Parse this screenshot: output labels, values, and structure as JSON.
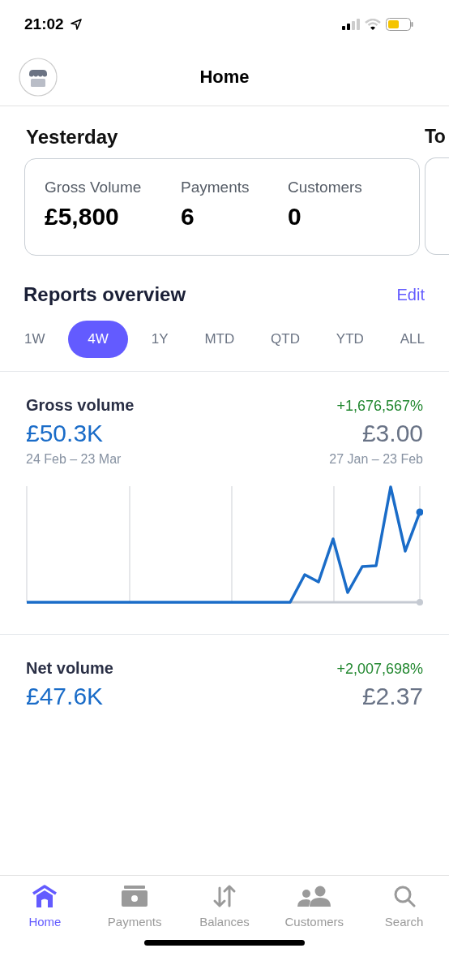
{
  "status_bar": {
    "time": "21:02"
  },
  "header": {
    "title": "Home"
  },
  "summaries": [
    {
      "title": "Yesterday",
      "stats": [
        {
          "label": "Gross Volume",
          "value": "£5,800"
        },
        {
          "label": "Payments",
          "value": "6"
        },
        {
          "label": "Customers",
          "value": "0"
        }
      ]
    },
    {
      "title": "To"
    }
  ],
  "reports": {
    "title": "Reports overview",
    "edit": "Edit",
    "periods": [
      {
        "label": "1W",
        "selected": false
      },
      {
        "label": "4W",
        "selected": true
      },
      {
        "label": "1Y",
        "selected": false
      },
      {
        "label": "MTD",
        "selected": false
      },
      {
        "label": "QTD",
        "selected": false
      },
      {
        "label": "YTD",
        "selected": false
      },
      {
        "label": "ALL",
        "selected": false
      }
    ],
    "metrics": [
      {
        "kind": "chart",
        "title": "Gross volume",
        "change": "+1,676,567%",
        "value": "£50.3K",
        "previous": "£3.00",
        "range": "24 Feb – 23 Mar",
        "previous_range": "27 Jan – 23 Feb"
      },
      {
        "kind": "plain",
        "title": "Net volume",
        "change": "+2,007,698%",
        "value": "£47.6K",
        "previous": "£2.37"
      }
    ]
  },
  "tab_bar": [
    {
      "label": "Home",
      "kind": "home",
      "selected": true
    },
    {
      "label": "Payments",
      "kind": "payments",
      "selected": false
    },
    {
      "label": "Balances",
      "kind": "balances",
      "selected": false
    },
    {
      "label": "Customers",
      "kind": "customers",
      "selected": false
    },
    {
      "label": "Search",
      "kind": "search",
      "selected": false
    }
  ]
}
